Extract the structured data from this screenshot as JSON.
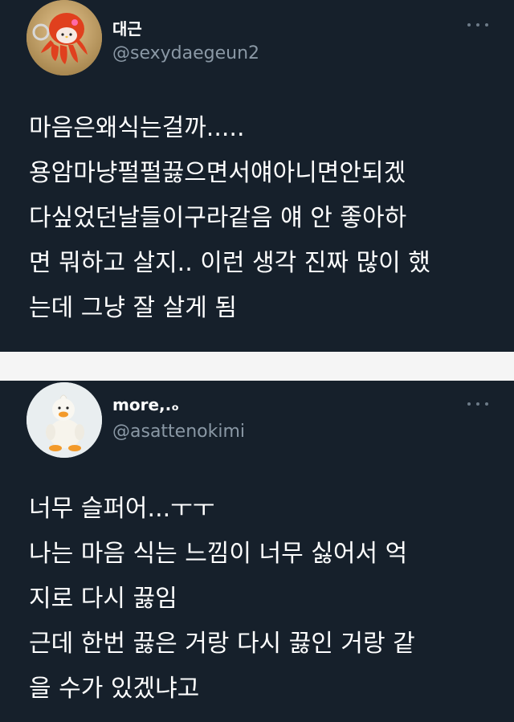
{
  "tweets": [
    {
      "display_name": "대근",
      "handle": "@sexydaegeun2",
      "lines": [
        "마음은왜식는걸까.....",
        "용암마냥펄펄끓으면서얘아니면안되겠",
        "다싶었던날들이구라같음 얘 안 좋아하",
        "면 뭐하고 살지.. 이런 생각 진짜 많이 했",
        "는데 그냥 잘 살게 됨"
      ],
      "avatar_icon": "octopus-avatar-icon",
      "more_icon": "more-dots-icon"
    },
    {
      "display_name": "more,.ₒ",
      "handle": "@asattenokimi",
      "lines": [
        "너무 슬퍼어...ㅜㅜ",
        "나는 마음 식는 느낌이 너무 싫어서 억",
        "지로 다시 끓임",
        "근데 한번 끓은 거랑 다시 끓인 거랑 같",
        "을 수가 있겠냐고"
      ],
      "avatar_icon": "duck-avatar-icon",
      "more_icon": "more-dots-icon"
    }
  ],
  "colors": {
    "background": "#16202b",
    "separator": "#f5f5f5",
    "text": "#ffffff",
    "handle": "#8a98a5"
  }
}
